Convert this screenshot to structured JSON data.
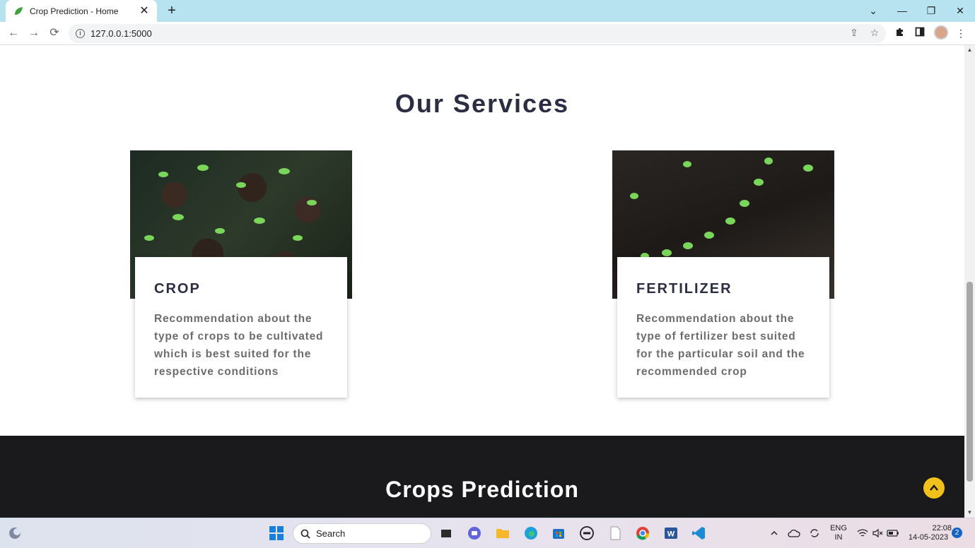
{
  "browser": {
    "tab_title": "Crop Prediction - Home",
    "url": "127.0.0.1:5000"
  },
  "page": {
    "services_title": "Our Services",
    "cards": [
      {
        "heading": "CROP",
        "text": "Recommendation about the type of crops to be cultivated which is best suited for the respective conditions"
      },
      {
        "heading": "FERTILIZER",
        "text": "Recommendation about the type of fertilizer best suited for the particular soil and the recommended crop"
      }
    ],
    "prediction_title": "Crops Prediction"
  },
  "taskbar": {
    "search_label": "Search",
    "lang_top": "ENG",
    "lang_bottom": "IN",
    "time": "22:08",
    "date": "14-05-2023",
    "notification_count": "2"
  },
  "colors": {
    "tabstrip": "#b7e3f0",
    "dark_section": "#1a1a1c",
    "accent_yellow": "#f2c01b",
    "heading": "#2b2d42"
  }
}
